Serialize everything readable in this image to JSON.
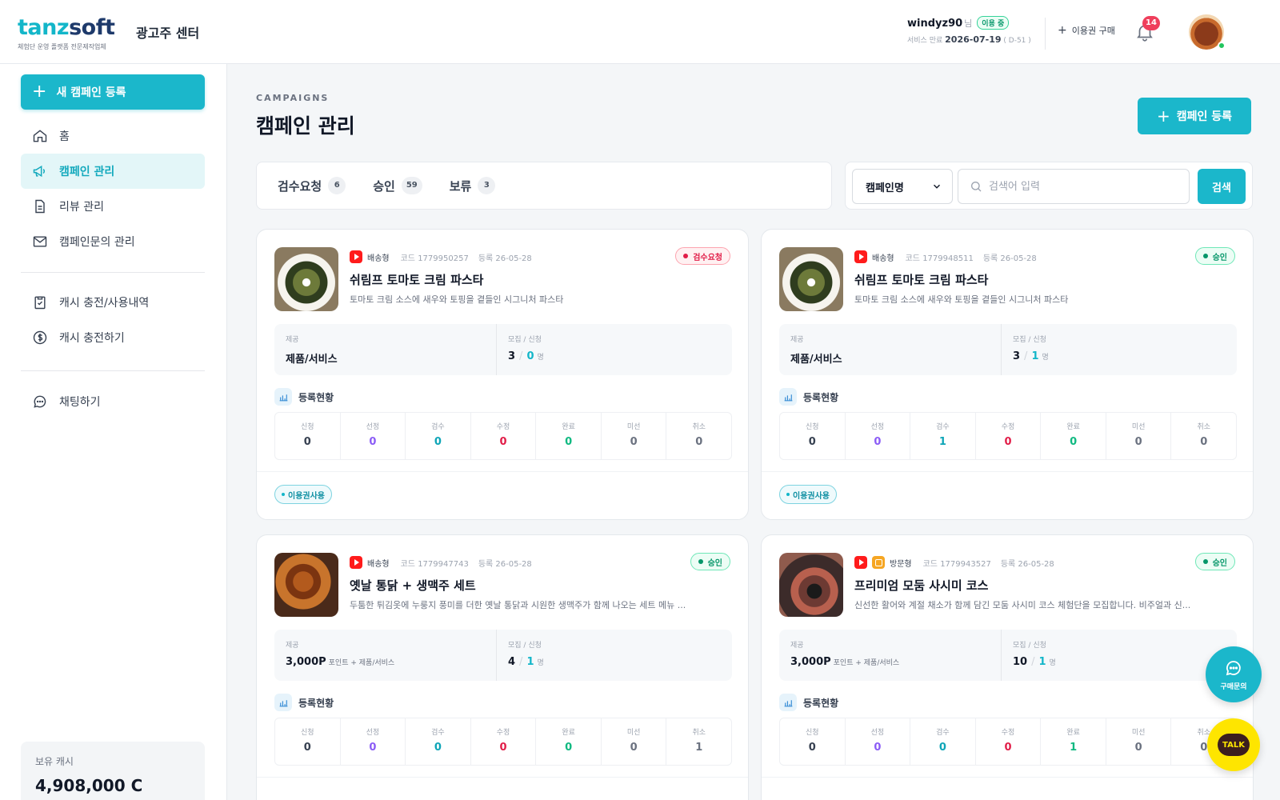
{
  "header": {
    "logo_a": "tanz",
    "logo_b": "soft",
    "logo_sub": "체험단 운영 플랫폼 전문제작업체",
    "brand_title": "광고주 센터",
    "user_name": "windyz90",
    "user_suffix": "님",
    "user_status": "이용 중",
    "expire_label": "서비스 만료",
    "expire_date": "2026-07-19",
    "expire_dday": "( D-51 )",
    "buy_pass": "이용권 구매",
    "notification_count": "14"
  },
  "sidebar": {
    "new_campaign": "새 캠페인 등록",
    "items": [
      {
        "label": "홈",
        "icon": "home-icon"
      },
      {
        "label": "캠페인 관리",
        "icon": "megaphone-icon"
      },
      {
        "label": "리뷰 관리",
        "icon": "document-icon"
      },
      {
        "label": "캠페인문의 관리",
        "icon": "mail-icon"
      },
      {
        "label": "캐시 충전/사용내역",
        "icon": "clipboard-icon"
      },
      {
        "label": "캐시 충전하기",
        "icon": "dollar-icon"
      },
      {
        "label": "채팅하기",
        "icon": "chat-icon"
      }
    ],
    "cash_label": "보유 캐시",
    "cash_value": "4,908,000 C"
  },
  "main": {
    "eyebrow": "CAMPAIGNS",
    "title": "캠페인 관리",
    "register": "캠페인 등록",
    "tabs": [
      {
        "label": "검수요청",
        "count": "6"
      },
      {
        "label": "승인",
        "count": "59"
      },
      {
        "label": "보류",
        "count": "3"
      }
    ],
    "search_filter": "캠페인명",
    "search_placeholder": "검색어 입력",
    "search_button": "검색"
  },
  "labels": {
    "provide": "제공",
    "recruit": "모집 / 신청",
    "unit": "명",
    "stats_title": "등록현황",
    "stat_names": [
      "신청",
      "선정",
      "검수",
      "수정",
      "완료",
      "미선",
      "취소"
    ]
  },
  "cards": [
    {
      "type": "배송형",
      "code": "코드 1779950257",
      "date": "등록 26-05-28",
      "status": "검수요청",
      "status_kind": "review",
      "title": "쉬림프 토마토 크림 파스타",
      "desc": "토마토 크림 소스에 새우와 토핑을 곁들인 시그니처 파스타",
      "provide_main": "제품/서비스",
      "provide_sub": "",
      "recruit": "3",
      "applied": "0",
      "stats": [
        "0",
        "0",
        "0",
        "0",
        "0",
        "0",
        "0"
      ],
      "tag": "이용권사용",
      "thumb": "pasta"
    },
    {
      "type": "배송형",
      "code": "코드 1779948511",
      "date": "등록 26-05-28",
      "status": "승인",
      "status_kind": "approved",
      "title": "쉬림프 토마토 크림 파스타",
      "desc": "토마토 크림 소스에 새우와 토핑을 곁들인 시그니처 파스타",
      "provide_main": "제품/서비스",
      "provide_sub": "",
      "recruit": "3",
      "applied": "1",
      "stats": [
        "0",
        "0",
        "1",
        "0",
        "0",
        "0",
        "0"
      ],
      "tag": "이용권사용",
      "thumb": "pasta"
    },
    {
      "type": "배송형",
      "code": "코드 1779947743",
      "date": "등록 26-05-28",
      "status": "승인",
      "status_kind": "approved",
      "title": "옛날 통닭 + 생맥주 세트",
      "desc": "두툼한 튀김옷에 누룽지 풍미를 더한 옛날 통닭과 시원한 생맥주가 함께 나오는 세트 메뉴 ...",
      "provide_main": "3,000P",
      "provide_sub": "포인트 + 제품/서비스",
      "recruit": "4",
      "applied": "1",
      "stats": [
        "0",
        "0",
        "0",
        "0",
        "0",
        "0",
        "1"
      ],
      "tag": "",
      "thumb": "chicken"
    },
    {
      "type": "방문형",
      "code": "코드 1779943527",
      "date": "등록 26-05-28",
      "status": "승인",
      "status_kind": "approved",
      "title": "프리미엄 모둠 사시미 코스",
      "desc": "신선한 활어와 계절 채소가 함께 담긴 모둠 사시미 코스 체험단을 모집합니다. 비주얼과 신...",
      "provide_main": "3,000P",
      "provide_sub": "포인트 + 제품/서비스",
      "recruit": "10",
      "applied": "1",
      "stats": [
        "0",
        "0",
        "0",
        "0",
        "1",
        "0",
        "0"
      ],
      "tag": "",
      "thumb": "sashimi"
    }
  ],
  "floating": {
    "inquiry": "구매문의",
    "talk": "TALK"
  }
}
